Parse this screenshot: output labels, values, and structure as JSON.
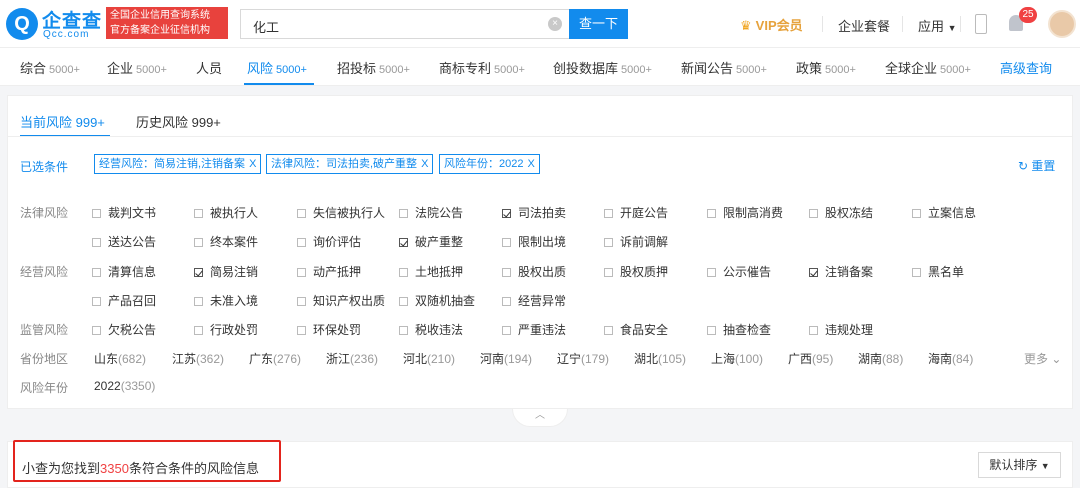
{
  "header": {
    "logo_cn": "企查查",
    "logo_en": "Qcc.com",
    "slogan_line1": "全国企业信用查询系统",
    "slogan_line2": "官方备案企业征信机构",
    "search_value": "化工",
    "search_button": "查一下",
    "vip_label": "VIP会员",
    "package_label": "企业套餐",
    "app_label": "应用",
    "notification_count": "25"
  },
  "nav": {
    "items": [
      {
        "label": "综合",
        "count": "5000+"
      },
      {
        "label": "企业",
        "count": "5000+"
      },
      {
        "label": "人员",
        "count": ""
      },
      {
        "label": "风险",
        "count": "5000+"
      },
      {
        "label": "招投标",
        "count": "5000+"
      },
      {
        "label": "商标专利",
        "count": "5000+"
      },
      {
        "label": "创投数据库",
        "count": "5000+"
      },
      {
        "label": "新闻公告",
        "count": "5000+"
      },
      {
        "label": "政策",
        "count": "5000+"
      },
      {
        "label": "全球企业",
        "count": "5000+"
      }
    ],
    "advanced": "高级查询"
  },
  "filter": {
    "tabs": [
      "当前风险 999+",
      "历史风险 999+"
    ],
    "selected_label": "已选条件",
    "chips": [
      "经营风险：简易注销,注销备案",
      "法律风险：司法拍卖,破产重整",
      "风险年份：2022"
    ],
    "chip_close": "X",
    "reset": "重置",
    "row_labels": {
      "legal": "法律风险",
      "business": "经营风险",
      "regulatory": "监管风险",
      "province": "省份地区",
      "year": "风险年份"
    },
    "legal": [
      "裁判文书",
      "被执行人",
      "失信被执行人",
      "法院公告",
      "司法拍卖",
      "开庭公告",
      "限制高消费",
      "股权冻结",
      "立案信息",
      "送达公告",
      "终本案件",
      "询价评估",
      "破产重整",
      "限制出境",
      "诉前调解"
    ],
    "business": [
      "清算信息",
      "简易注销",
      "动产抵押",
      "土地抵押",
      "股权出质",
      "股权质押",
      "公示催告",
      "注销备案",
      "黑名单",
      "产品召回",
      "未准入境",
      "知识产权出质",
      "双随机抽查",
      "经营异常"
    ],
    "regulatory": [
      "欠税公告",
      "行政处罚",
      "环保处罚",
      "税收违法",
      "严重违法",
      "食品安全",
      "抽查检查",
      "违规处理"
    ],
    "provinces": [
      {
        "name": "山东",
        "count": "(682)"
      },
      {
        "name": "江苏",
        "count": "(362)"
      },
      {
        "name": "广东",
        "count": "(276)"
      },
      {
        "name": "浙江",
        "count": "(236)"
      },
      {
        "name": "河北",
        "count": "(210)"
      },
      {
        "name": "河南",
        "count": "(194)"
      },
      {
        "name": "辽宁",
        "count": "(179)"
      },
      {
        "name": "湖北",
        "count": "(105)"
      },
      {
        "name": "上海",
        "count": "(100)"
      },
      {
        "name": "广西",
        "count": "(95)"
      },
      {
        "name": "湖南",
        "count": "(88)"
      },
      {
        "name": "海南",
        "count": "(84)"
      }
    ],
    "more": "更多",
    "year_value": "2022",
    "year_count": "(3350)"
  },
  "result": {
    "prefix": "小查为您找到",
    "count": "3350",
    "suffix": "条符合条件的风险信息",
    "sort": "默认排序"
  },
  "colors": {
    "accent": "#128bed",
    "danger": "#f04142",
    "vip": "#e6a23c"
  }
}
